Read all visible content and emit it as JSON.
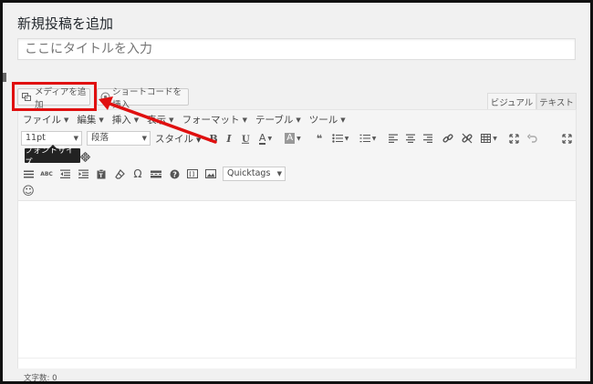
{
  "page": {
    "heading": "新規投稿を追加",
    "title_placeholder": "ここにタイトルを入力"
  },
  "buttons": {
    "add_media": "メディアを追加",
    "insert_shortcode": "ショートコードを挿入"
  },
  "tabs": [
    {
      "label": "ビジュアル",
      "active": true
    },
    {
      "label": "テキスト",
      "active": false
    }
  ],
  "menubar": [
    {
      "label": "ファイル"
    },
    {
      "label": "編集"
    },
    {
      "label": "挿入"
    },
    {
      "label": "表示"
    },
    {
      "label": "フォーマット"
    },
    {
      "label": "テーブル"
    },
    {
      "label": "ツール"
    }
  ],
  "toolbar": {
    "font_size_value": "11pt",
    "paragraph_value": "段落",
    "style_label": "スタイル",
    "bold_glyph": "B",
    "italic_glyph": "I",
    "text_color_glyph": "A",
    "bg_color_glyph": "A",
    "quote_glyph": "❝",
    "omega_glyph": "Ω",
    "abc_glyph": "ABC",
    "quicktags_value": "Quicktags",
    "emoji_glyph": "☺"
  },
  "tooltip": {
    "text": "フォントサイズ"
  },
  "status": {
    "word_count": "文字数: 0"
  },
  "colors": {
    "highlight": "#e01010",
    "arrow": "#e01010",
    "tooltip_bg": "#222222"
  },
  "icons": [
    "media-icon",
    "shortcode-icon",
    "bold-icon",
    "italic-icon",
    "text-color-icon",
    "background-color-icon",
    "blockquote-icon",
    "bullet-list-icon",
    "numbered-list-icon",
    "align-left-icon",
    "align-center-icon",
    "align-right-icon",
    "link-icon",
    "unlink-icon",
    "table-icon",
    "fullscreen-icon",
    "undo-icon",
    "expand-icon",
    "move-icon",
    "horizontal-rule-icon",
    "spellcheck-icon",
    "outdent-icon",
    "indent-icon",
    "paste-text-icon",
    "clear-format-icon",
    "special-char-icon",
    "more-tag-icon",
    "help-icon",
    "shortcode-block-icon",
    "image-icon",
    "emoji-icon"
  ]
}
